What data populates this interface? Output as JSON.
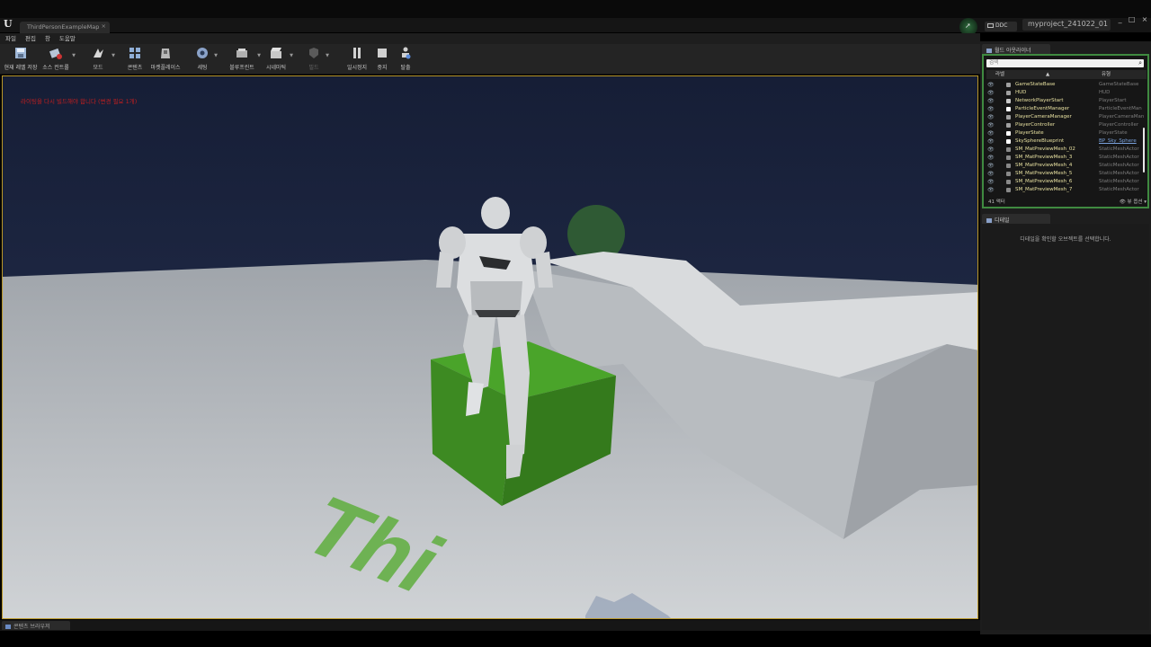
{
  "title_bar": {
    "map_tab": "ThirdPersonExampleMap",
    "ddc_label": "DDC",
    "project_name": "myproject_241022_01",
    "window_controls": [
      "_",
      "□",
      "×"
    ]
  },
  "menu": [
    "파일",
    "편집",
    "창",
    "도움말"
  ],
  "toolbar": [
    {
      "label": "현재 레벨 저장",
      "icon": "save-icon",
      "color": "#9fb8d8"
    },
    {
      "label": "소스 컨트롤",
      "icon": "source-control-icon",
      "color": "#b7c4d6"
    },
    {
      "label": "모드",
      "icon": "modes-icon",
      "color": "#d8d8d8"
    },
    {
      "label": "콘텐츠",
      "icon": "content-icon",
      "color": "#8faed6"
    },
    {
      "label": "마켓플레이스",
      "icon": "marketplace-icon",
      "color": "#b8b8b8"
    },
    {
      "label": "세팅",
      "icon": "settings-icon",
      "color": "#8aa2c8"
    },
    {
      "label": "블루프린트",
      "icon": "blueprint-icon",
      "color": "#b0b0b0"
    },
    {
      "label": "시네마틱",
      "icon": "cinematics-icon",
      "color": "#c8c8c8"
    },
    {
      "label": "빌드",
      "icon": "build-icon",
      "color": "#5a5a5a"
    },
    {
      "label": "일시정지",
      "icon": "pause-icon",
      "color": "#d0d0d0"
    },
    {
      "label": "중지",
      "icon": "stop-icon",
      "color": "#d0d0d0"
    },
    {
      "label": "탈출",
      "icon": "eject-icon",
      "color": "#d0d0d0"
    }
  ],
  "viewport": {
    "message": "라이팅을 다시 빌드해야 합니다 (변경 필요 1개)",
    "floor_text": "Thi",
    "colors": {
      "sky": "#1c2540",
      "floor": "#b8bcc0",
      "cube": "#3e8a22",
      "accent_border": "#b89628"
    }
  },
  "content_browser_tab": "콘텐츠 브라우저",
  "world_outliner": {
    "tab_label": "월드 아웃라이너",
    "search_placeholder": "검색",
    "col_label": "라벨",
    "col_type": "유형",
    "rows": [
      {
        "label": "GameStateBase",
        "type": "GameStateBase",
        "icon_color": "#a0a0a0",
        "link": false
      },
      {
        "label": "HUD",
        "type": "HUD",
        "icon_color": "#a0a0a0",
        "link": false
      },
      {
        "label": "NetworkPlayerStart",
        "type": "PlayerStart",
        "icon_color": "#c8c8c8",
        "link": false
      },
      {
        "label": "ParticleEventManager",
        "type": "ParticleEventMan",
        "icon_color": "#ffffff",
        "link": false
      },
      {
        "label": "PlayerCameraManager",
        "type": "PlayerCameraMan",
        "icon_color": "#a0a0a0",
        "link": false
      },
      {
        "label": "PlayerController",
        "type": "PlayerController",
        "icon_color": "#a0a0a0",
        "link": false
      },
      {
        "label": "PlayerState",
        "type": "PlayerState",
        "icon_color": "#ffffff",
        "link": false
      },
      {
        "label": "SkySphereBlueprint",
        "type": "BP_Sky_Sphere",
        "icon_color": "#ffffff",
        "link": true
      },
      {
        "label": "SM_MatPreviewMesh_02",
        "type": "StaticMeshActor",
        "icon_color": "#888888",
        "link": false
      },
      {
        "label": "SM_MatPreviewMesh_3",
        "type": "StaticMeshActor",
        "icon_color": "#888888",
        "link": false
      },
      {
        "label": "SM_MatPreviewMesh_4",
        "type": "StaticMeshActor",
        "icon_color": "#888888",
        "link": false
      },
      {
        "label": "SM_MatPreviewMesh_5",
        "type": "StaticMeshActor",
        "icon_color": "#888888",
        "link": false
      },
      {
        "label": "SM_MatPreviewMesh_6",
        "type": "StaticMeshActor",
        "icon_color": "#888888",
        "link": false
      },
      {
        "label": "SM_MatPreviewMesh_7",
        "type": "StaticMeshActor",
        "icon_color": "#888888",
        "link": false
      }
    ],
    "actor_count": "41 액터",
    "view_options": "뷰 옵션"
  },
  "details": {
    "tab_label": "디테일",
    "hint": "디테일을 확인할 오브젝트를 선택합니다."
  }
}
